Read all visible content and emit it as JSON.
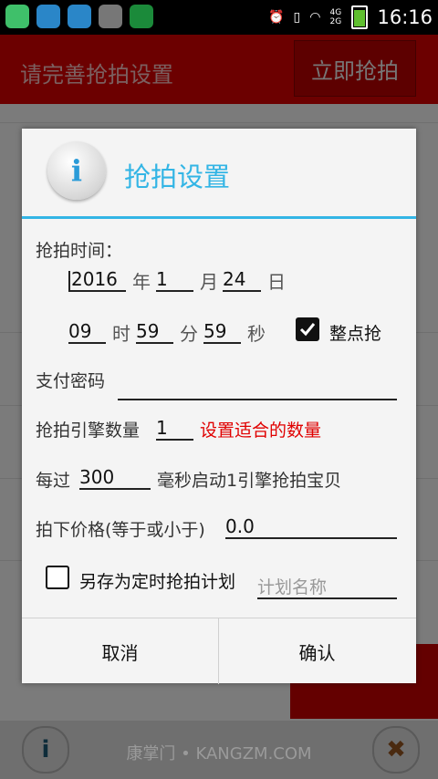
{
  "status_bar": {
    "time": "16:16",
    "network": "4G 2G"
  },
  "app_bar": {
    "title": "请完善抢拍设置",
    "action_label": "立即抢拍"
  },
  "dialog": {
    "title": "抢拍设置",
    "time_label": "抢拍时间：",
    "year": {
      "value": "2016",
      "unit": "年"
    },
    "month": {
      "value": "1",
      "unit": "月"
    },
    "day": {
      "value": "24",
      "unit": "日"
    },
    "hour": {
      "value": "09",
      "unit": "时"
    },
    "minute": {
      "value": "59",
      "unit": "分"
    },
    "second": {
      "value": "59",
      "unit": "秒"
    },
    "on_the_hour": {
      "label": "整点抢",
      "checked": true
    },
    "password": {
      "label": "支付密码",
      "value": ""
    },
    "engine_count": {
      "label": "抢拍引擎数量",
      "value": "1",
      "hint": "设置适合的数量"
    },
    "interval": {
      "prefix": "每过",
      "value": "300",
      "suffix": "毫秒启动1引擎抢拍宝贝"
    },
    "price": {
      "label": "拍下价格(等于或小于)",
      "value": "0.0"
    },
    "save_plan": {
      "label": "另存为定时抢拍计划",
      "checked": false,
      "placeholder": "计划名称"
    },
    "cancel_label": "取消",
    "confirm_label": "确认"
  },
  "footer": {
    "text": "康掌门 • KANGZM.COM"
  },
  "colors": {
    "accent": "#33b5e5",
    "hint": "#e00000",
    "app_bar": "#6c0000"
  },
  "icons": [
    "info-icon",
    "close-icon",
    "checkbox-checked-icon",
    "checkbox-unchecked-icon",
    "alarm-icon",
    "wifi-icon",
    "battery-icon"
  ]
}
